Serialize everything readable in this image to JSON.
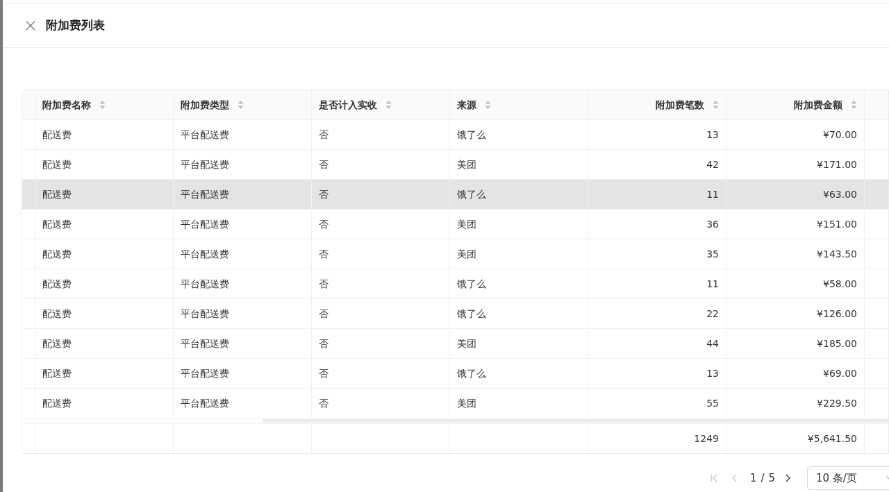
{
  "drawer": {
    "title": "附加费列表"
  },
  "table": {
    "columns": [
      {
        "label": "附加费名称",
        "kind": "text"
      },
      {
        "label": "附加费类型",
        "kind": "text"
      },
      {
        "label": "是否计入实收",
        "kind": "text"
      },
      {
        "label": "来源",
        "kind": "text"
      },
      {
        "label": "附加费笔数",
        "kind": "number"
      },
      {
        "label": "附加费金额",
        "kind": "number"
      }
    ],
    "rows": [
      {
        "cells": [
          "配送费",
          "平台配送费",
          "否",
          "饿了么",
          "13",
          "¥70.00"
        ],
        "highlighted": false
      },
      {
        "cells": [
          "配送费",
          "平台配送费",
          "否",
          "美团",
          "42",
          "¥171.00"
        ],
        "highlighted": false
      },
      {
        "cells": [
          "配送费",
          "平台配送费",
          "否",
          "饿了么",
          "11",
          "¥63.00"
        ],
        "highlighted": true
      },
      {
        "cells": [
          "配送费",
          "平台配送费",
          "否",
          "美团",
          "36",
          "¥151.00"
        ],
        "highlighted": false
      },
      {
        "cells": [
          "配送费",
          "平台配送费",
          "否",
          "美团",
          "35",
          "¥143.50"
        ],
        "highlighted": false
      },
      {
        "cells": [
          "配送费",
          "平台配送费",
          "否",
          "饿了么",
          "11",
          "¥58.00"
        ],
        "highlighted": false
      },
      {
        "cells": [
          "配送费",
          "平台配送费",
          "否",
          "饿了么",
          "22",
          "¥126.00"
        ],
        "highlighted": false
      },
      {
        "cells": [
          "配送费",
          "平台配送费",
          "否",
          "美团",
          "44",
          "¥185.00"
        ],
        "highlighted": false
      },
      {
        "cells": [
          "配送费",
          "平台配送费",
          "否",
          "饿了么",
          "13",
          "¥69.00"
        ],
        "highlighted": false
      },
      {
        "cells": [
          "配送费",
          "平台配送费",
          "否",
          "美团",
          "55",
          "¥229.50"
        ],
        "highlighted": false
      }
    ],
    "summary": {
      "count": "1249",
      "amount": "¥5,641.50"
    }
  },
  "pagination": {
    "first_disabled": true,
    "prev_disabled": true,
    "next_disabled": false,
    "current": "1",
    "separator": "/",
    "total": "5",
    "page_size": "10 条/页"
  }
}
